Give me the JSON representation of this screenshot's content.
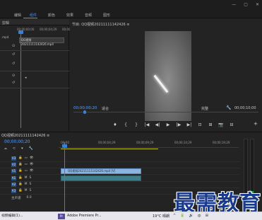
{
  "menubar": {
    "items": [
      "编辑",
      "组件",
      "颜色",
      "效果",
      "音频",
      "图形"
    ],
    "active_index": 1
  },
  "window_controls": {
    "minimize": "—",
    "maximize": "▢",
    "close": "✕"
  },
  "left_panel": {
    "title": "剪辑",
    "timecode_start": "00;00;00;00",
    "timecode_mid": "00;00;04;29",
    "timecode_end": "00;00",
    "clip_name": "QQ视频20211111142426.mp4",
    "side_label": ".mp4"
  },
  "program": {
    "title": "节目: QQ视频20211111142426 ≡",
    "timecode": "00;00;00;20",
    "fit": "适合",
    "quality": "完整",
    "duration": "00;00;10;00"
  },
  "transport": [
    "♦",
    "{",
    "}",
    "|◀",
    "◀|",
    "▶",
    "|▶",
    "▶|",
    "⊡",
    "⊞",
    "📷",
    "⊟"
  ],
  "transport_add": "+",
  "timeline": {
    "title": "QQ视频20211111142426 ≡",
    "timecode": "00;00;00;20",
    "ruler_labels": [
      ":00;00",
      "00;00;04;29",
      "00;00;09;29",
      "00;00;14;29",
      "00;00;19;29"
    ],
    "tracks": [
      {
        "name": "V3",
        "toggles": [
          "🔒",
          "▭",
          "👁"
        ]
      },
      {
        "name": "V2",
        "toggles": [
          "🔒",
          "▭",
          "👁"
        ]
      },
      {
        "name": "V1",
        "toggles": [
          "🔒",
          "▭",
          "👁"
        ]
      },
      {
        "name": "A1",
        "toggles": [
          "🔒",
          "M",
          "S"
        ]
      },
      {
        "name": "A2",
        "toggles": [
          "🔒",
          "M",
          "S"
        ]
      },
      {
        "name": "A3",
        "toggles": [
          "🔒",
          "M",
          "S"
        ]
      }
    ],
    "master_label": "主声道",
    "master_value": "0.0",
    "video_clip": "QQ视频20211111142426.mp4 [V]",
    "audio_clip": "",
    "meter_levels": [
      0.18,
      0.22
    ]
  },
  "watermark": "最需教育",
  "taskbar": {
    "items": [
      "视频编辑(1)...",
      "Adobe Premiere Pr..."
    ],
    "weather": "19°C 晴朗",
    "tray": [
      "^",
      "🔋",
      "🔊",
      "中",
      "⊞"
    ]
  },
  "colors": {
    "accent": "#3f7fd1",
    "timecode": "#5aa0ff",
    "video_clip": "#8cb4e0",
    "audio_clip": "#3f7f8a",
    "watermark": "#1a3a8c"
  }
}
